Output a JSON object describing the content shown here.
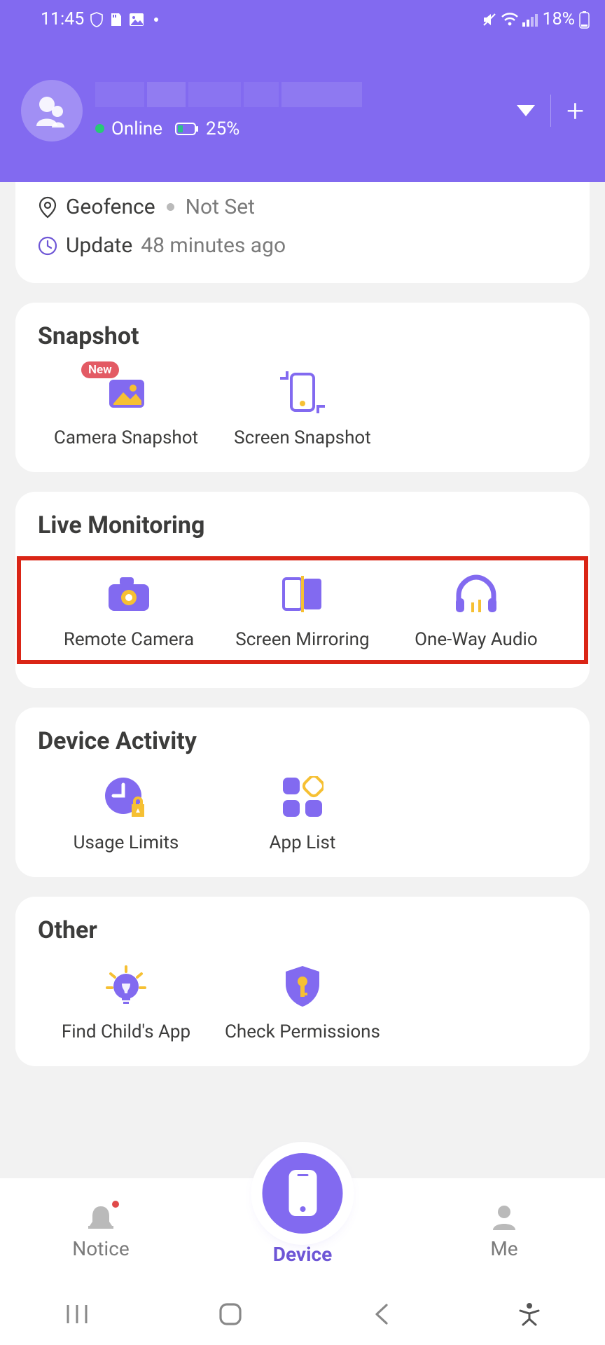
{
  "status_bar": {
    "time": "11:45",
    "battery_pct": "18%"
  },
  "header": {
    "online_label": "Online",
    "device_battery": "25%"
  },
  "info_card": {
    "geofence_label": "Geofence",
    "geofence_value": "Not Set",
    "update_label": "Update",
    "update_value": "48 minutes ago"
  },
  "sections": {
    "snapshot": {
      "title": "Snapshot",
      "items": [
        {
          "label": "Camera Snapshot",
          "badge": "New"
        },
        {
          "label": "Screen Snapshot"
        }
      ]
    },
    "live_monitoring": {
      "title": "Live Monitoring",
      "items": [
        {
          "label": "Remote Camera"
        },
        {
          "label": "Screen Mirroring"
        },
        {
          "label": "One-Way Audio"
        }
      ]
    },
    "device_activity": {
      "title": "Device Activity",
      "items": [
        {
          "label": "Usage Limits"
        },
        {
          "label": "App List"
        }
      ]
    },
    "other": {
      "title": "Other",
      "items": [
        {
          "label": "Find Child's App"
        },
        {
          "label": "Check Permissions"
        }
      ]
    }
  },
  "bottom_nav": {
    "notice": "Notice",
    "device": "Device",
    "me": "Me"
  }
}
